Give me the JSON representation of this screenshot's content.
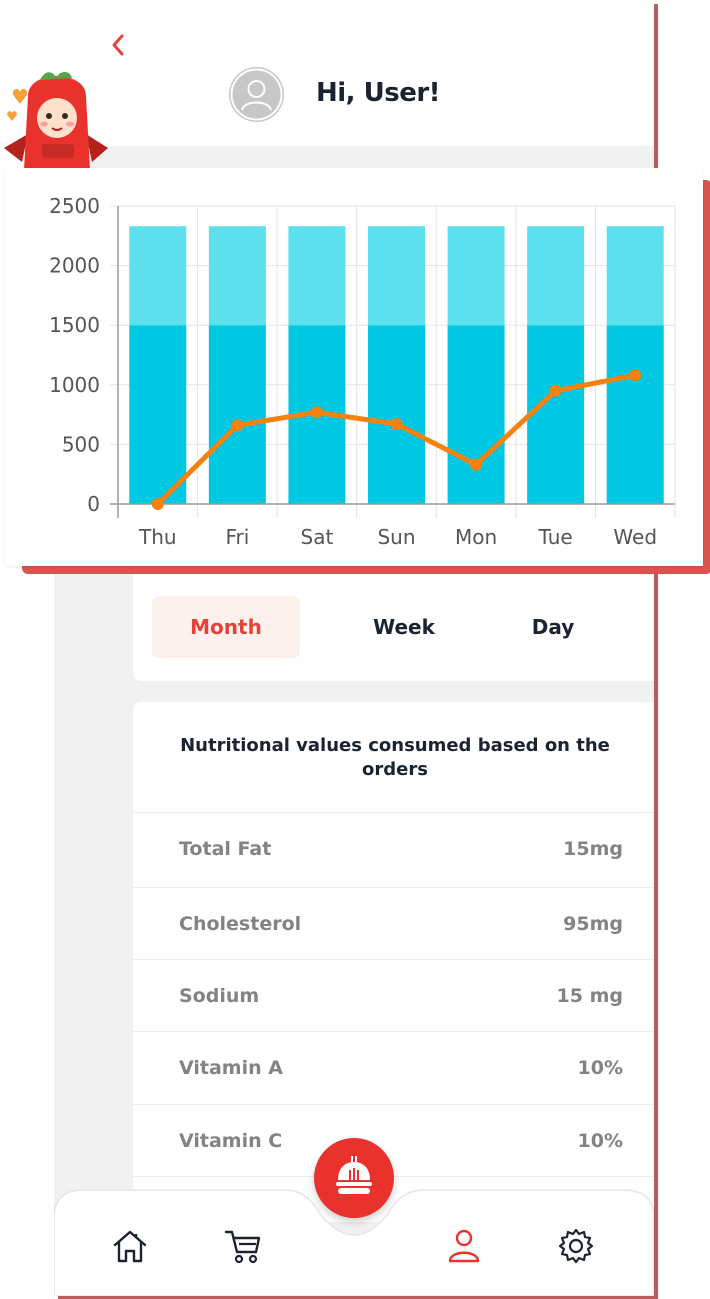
{
  "header": {
    "greeting": "Hi, User!"
  },
  "chart_data": {
    "type": "bar",
    "categories": [
      "Thu",
      "Fri",
      "Sat",
      "Sun",
      "Mon",
      "Tue",
      "Wed"
    ],
    "ylim": [
      0,
      2500
    ],
    "yticks": [
      "2500",
      "2000",
      "1500",
      "1000",
      "500",
      "0"
    ],
    "series": [
      {
        "type": "bar",
        "values": [
          1500,
          1500,
          1500,
          1500,
          1500,
          1500,
          1500
        ],
        "color": "#00c7e2"
      },
      {
        "type": "bar-stacked",
        "values": [
          830,
          830,
          830,
          830,
          830,
          830,
          830
        ],
        "color": "#5ce0ee"
      },
      {
        "type": "line",
        "values": [
          0,
          660,
          770,
          670,
          330,
          950,
          1080
        ],
        "color": "#f5810f"
      }
    ],
    "grid": true
  },
  "tabs": [
    {
      "label": "Month",
      "active": true
    },
    {
      "label": "Week",
      "active": false
    },
    {
      "label": "Day",
      "active": false
    }
  ],
  "nutrition": {
    "title": "Nutritional values consumed based on the orders",
    "rows": [
      {
        "name": "Total Fat",
        "value": "15mg"
      },
      {
        "name": "Cholesterol",
        "value": "95mg"
      },
      {
        "name": "Sodium",
        "value": "15 mg"
      },
      {
        "name": "Vitamin A",
        "value": "10%"
      },
      {
        "name": "Vitamin C",
        "value": "10%"
      }
    ]
  },
  "nav": {
    "items": [
      "home-icon",
      "cart-icon",
      "food-icon",
      "user-icon",
      "settings-icon"
    ],
    "active": "user-icon",
    "accent_color": "#e8322b"
  },
  "colors": {
    "accent": "#e5423a",
    "text_dark": "#1b2333",
    "text_muted": "#838383"
  }
}
